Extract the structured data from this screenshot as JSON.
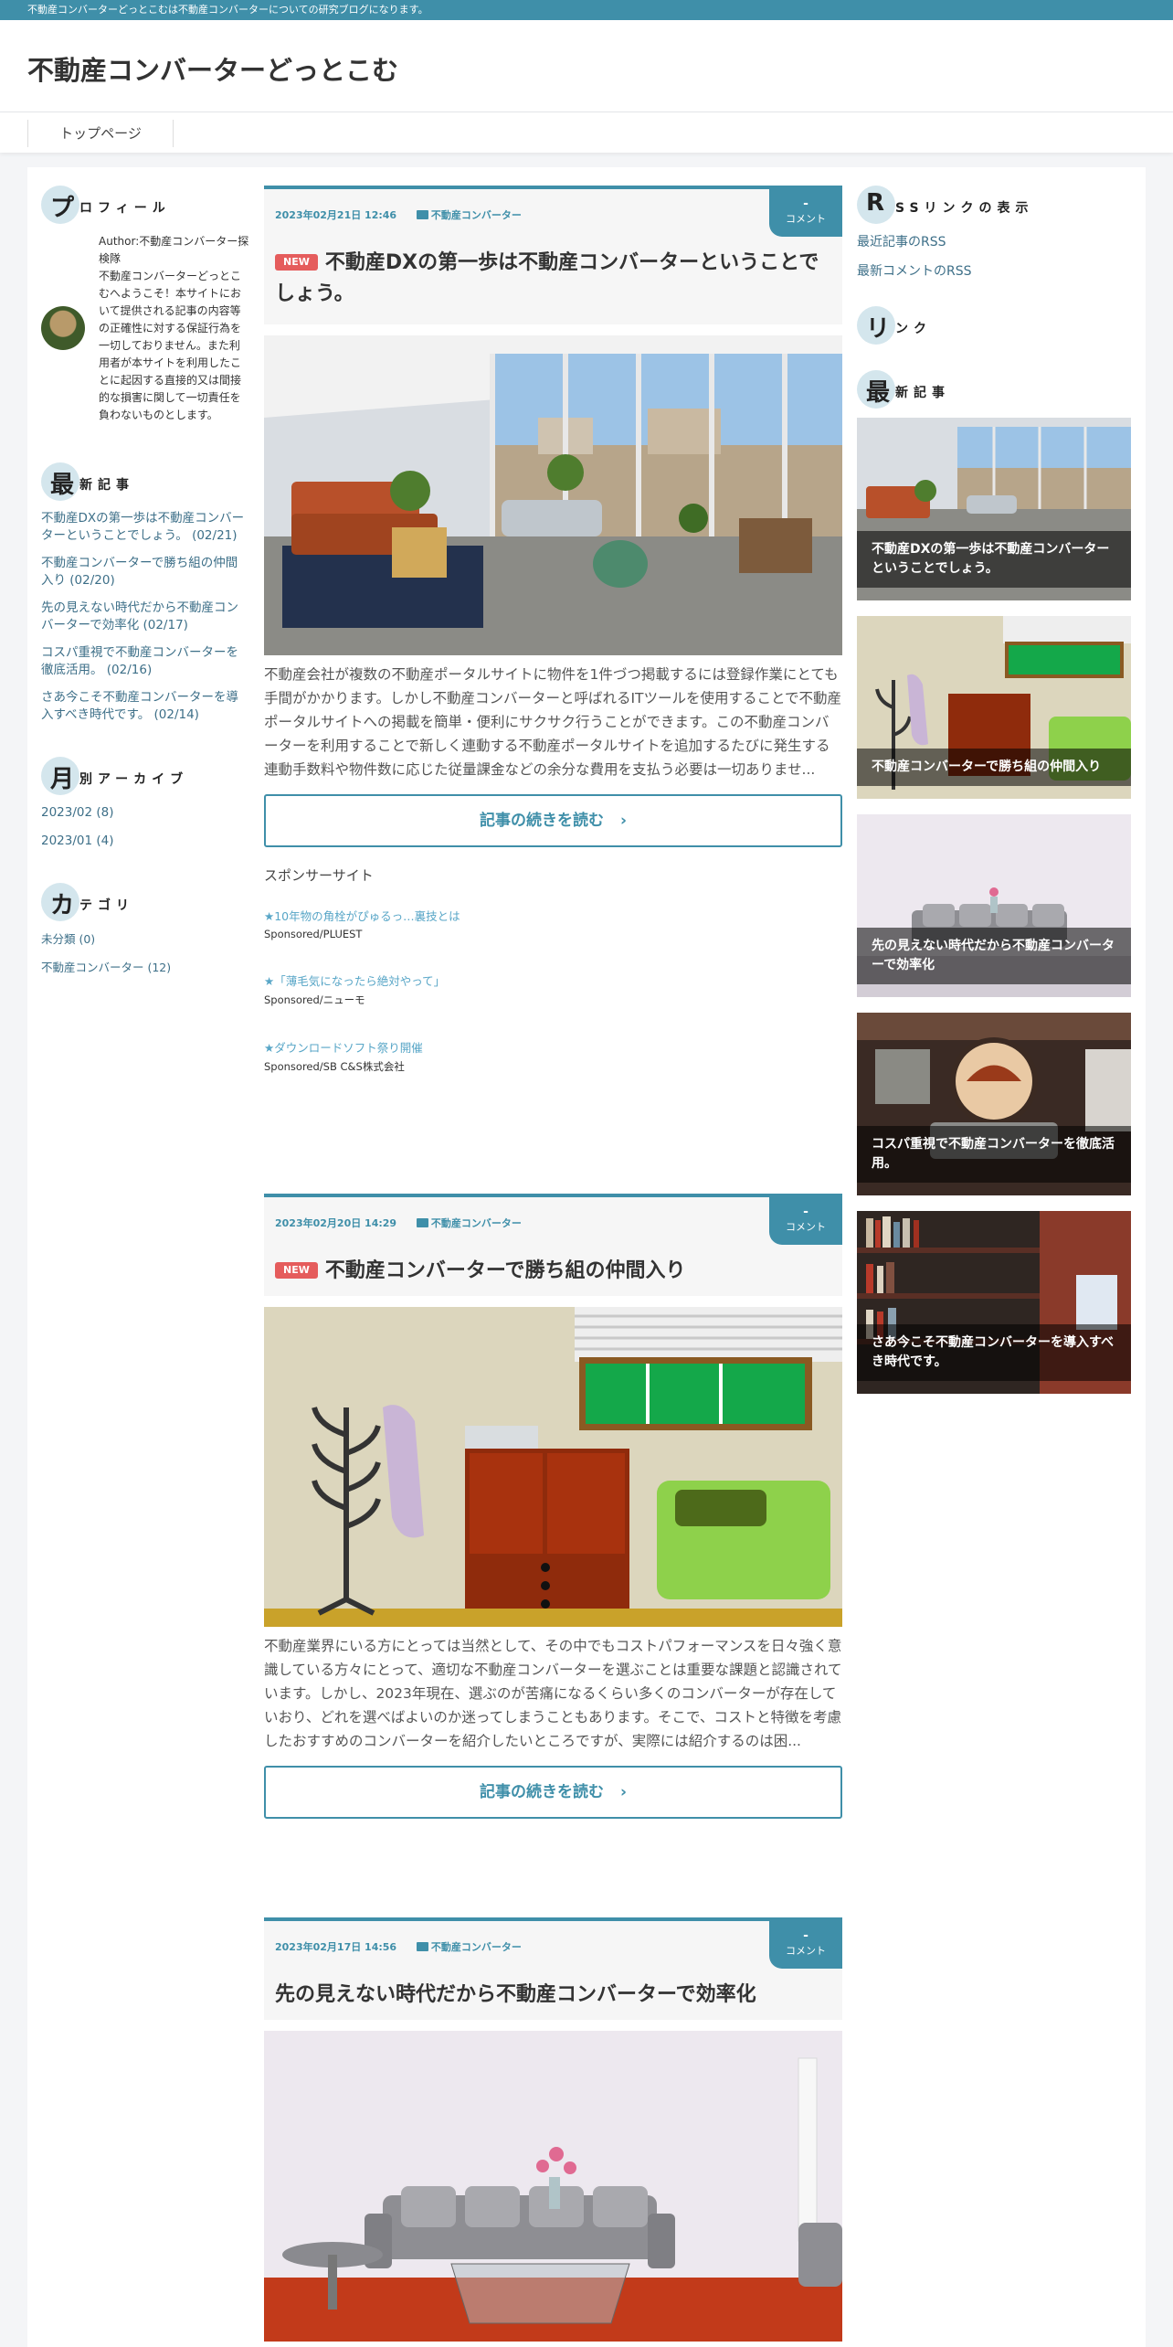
{
  "topbar": {
    "text": "不動産コンバーターどっとこむは不動産コンバーターについての研究ブログになります。"
  },
  "site": {
    "title": "不動産コンバーターどっとこむ"
  },
  "nav": {
    "items": [
      {
        "label": "トップページ"
      }
    ]
  },
  "colors": {
    "accent": "#3f8fa9",
    "new_badge": "#e55c5c"
  },
  "left": {
    "profile": {
      "title_first": "プ",
      "title_rest": "ロフィール",
      "text": "Author:不動産コンバーター探検隊\n不動産コンバーターどっとこむへようこそ！本サイトにおいて提供される記事の内容等の正確性に対する保証行為を一切しておりません。また利用者が本サイトを利用したことに起因する直接的又は間接的な損害に関して一切責任を負わないものとします。"
    },
    "recent": {
      "title_first": "最",
      "title_rest": "新記事",
      "items": [
        "不動産DXの第一歩は不動産コンバーターということでしょう。 (02/21)",
        "不動産コンバーターで勝ち組の仲間入り (02/20)",
        "先の見えない時代だから不動産コンバーターで効率化 (02/17)",
        "コスパ重視で不動産コンバーターを徹底活用。 (02/16)",
        "さあ今こそ不動産コンバーターを導入すべき時代です。 (02/14)"
      ]
    },
    "archive": {
      "title_first": "月",
      "title_rest": "別アーカイブ",
      "items": [
        "2023/02 (8)",
        "2023/01 (4)"
      ]
    },
    "category": {
      "title_first": "カ",
      "title_rest": "テゴリ",
      "items": [
        "未分類 (0)",
        "不動産コンバーター (12)"
      ]
    }
  },
  "posts": [
    {
      "date": "2023年02月21日 12:46",
      "category": "不動産コンバーター",
      "comment_count": "-",
      "comment_label": "コメント",
      "new": "NEW",
      "title": "不動産DXの第一歩は不動産コンバーターということでしょう。",
      "excerpt": "不動産会社が複数の不動産ポータルサイトに物件を1件づつ掲載するには登録作業にとても手間がかかります。しかし不動産コンバーターと呼ばれるITツールを使用することで不動産ポータルサイトへの掲載を簡単・便利にサクサク行うことができます。この不動産コンバーターを利用することで新しく連動する不動産ポータルサイトを追加するたびに発生する連動手数料や物件数に応じた従量課金などの余分な費用を支払う必要は一切ありませ...",
      "more": "記事の続きを読む"
    },
    {
      "date": "2023年02月20日 14:29",
      "category": "不動産コンバーター",
      "comment_count": "-",
      "comment_label": "コメント",
      "new": "NEW",
      "title": "不動産コンバーターで勝ち組の仲間入り",
      "excerpt": "不動産業界にいる方にとっては当然として、その中でもコストパフォーマンスを日々強く意識している方々にとって、適切な不動産コンバーターを選ぶことは重要な課題と認識されています。しかし、2023年現在、選ぶのが苦痛になるくらい多くのコンバーターが存在していおり、どれを選べばよいのか迷ってしまうこともあります。そこで、コストと特徴を考慮したおすすめのコンバーターを紹介したいところですが、実際には紹介するのは困...",
      "more": "記事の続きを読む"
    },
    {
      "date": "2023年02月17日 14:56",
      "category": "不動産コンバーター",
      "comment_count": "-",
      "comment_label": "コメント",
      "title": "先の見えない時代だから不動産コンバーターで効率化"
    }
  ],
  "sponsor": {
    "heading": "スポンサーサイト",
    "ads": [
      {
        "title": "★10年物の角栓がぴゅるっ…裏技とは",
        "source": "Sponsored/PLUEST"
      },
      {
        "title": "★「薄毛気になったら絶対やって」",
        "source": "Sponsored/ニューモ"
      },
      {
        "title": "★ダウンロードソフト祭り開催",
        "source": "Sponsored/SB C&S株式会社"
      }
    ]
  },
  "right": {
    "rss": {
      "title_first": "R",
      "title_rest": "SSリンクの表示",
      "items": [
        "最近記事のRSS",
        "最新コメントのRSS"
      ]
    },
    "links": {
      "title_first": "リ",
      "title_rest": "ンク"
    },
    "recent": {
      "title_first": "最",
      "title_rest": "新記事",
      "items": [
        "不動産DXの第一歩は不動産コンバーターということでしょう。",
        "不動産コンバーターで勝ち組の仲間入り",
        "先の見えない時代だから不動産コンバーターで効率化",
        "コスパ重視で不動産コンバーターを徹底活用。",
        "さあ今こそ不動産コンバーターを導入すべき時代です。"
      ]
    }
  }
}
